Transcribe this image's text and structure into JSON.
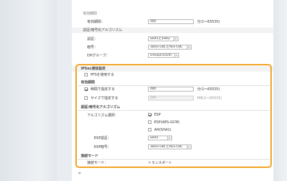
{
  "top": {
    "section_title": "有効期間",
    "row1": {
      "label": "有効期間：",
      "value": "480",
      "unit": "分(1〜65535)"
    }
  },
  "auth_section": {
    "title": "認証/暗号化アルゴリズム",
    "auth_label": "認証：",
    "auth_value": "SHA1とSHA2",
    "enc_label": "暗号：",
    "enc_value": "3DES-CBCとAES-CBC",
    "dh_label": "DHグループ：",
    "dh_value": "Group2(1024)"
  },
  "ipsec": {
    "title": "IPSec通信設定",
    "pfs_label": "PFSを使用する",
    "validity_title": "有効期間",
    "time_label": "時間で指定する",
    "time_value": "480",
    "time_unit": "分(1〜65535)",
    "size_label": "サイズで指定する",
    "size_value": "100",
    "size_unit": "MB(1〜65535)",
    "algo_title": "認証/暗号化アルゴリズム",
    "algo_select_label": "アルゴリズム選択：",
    "esp_label": "ESP",
    "esp_gcm_label": "ESP(AES-GCM)",
    "ah_label": "AH(SHA1)",
    "esp_auth_label": "ESP認証：",
    "esp_auth_value": "SHA1",
    "esp_enc_label": "ESP暗号：",
    "esp_enc_value": "3DES-CBCとAES-CBC",
    "conn_title": "接続モード",
    "conn_label": "接続モード：",
    "conn_value": "トランスポート"
  },
  "footnote": "≡"
}
